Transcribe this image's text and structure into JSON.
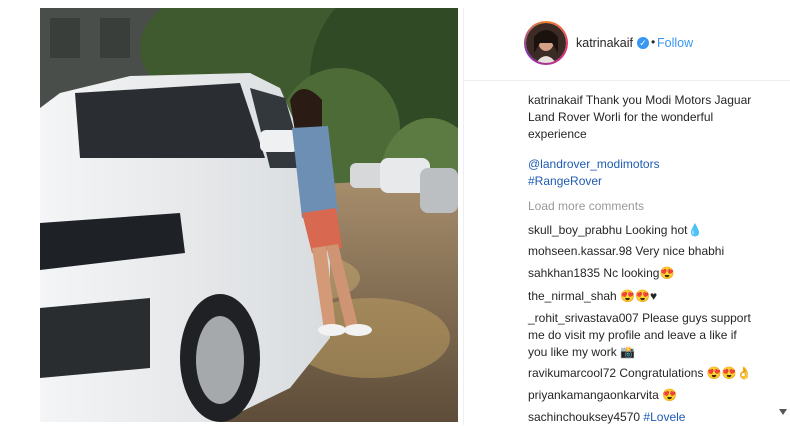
{
  "post": {
    "username": "katrinakaif",
    "follow_label": "Follow",
    "dot": "•",
    "caption_user": "katrinakaif",
    "caption_text": "Thank you Modi Motors Jaguar Land Rover Worli for the wonderful experience",
    "mention": "@landrover_modimotors",
    "hashtag": "#RangeRover",
    "load_more": "Load more comments"
  },
  "comments": [
    {
      "user": "skull_boy_prabhu",
      "text": "Looking hot💧"
    },
    {
      "user": "mohseen.kassar.98",
      "text": "Very nice bhabhi"
    },
    {
      "user": "sahkhan1835",
      "text": "Nc looking😍"
    },
    {
      "user": "the_nirmal_shah",
      "text": "😍😍♥"
    },
    {
      "user": "_rohit_srivastava007",
      "text": "Please guys support me do visit my profile and leave a like if you like my work 📸"
    },
    {
      "user": "ravikumarcool72",
      "text": "Congratulations 😍😍👌"
    },
    {
      "user": "priyankamangaonkarvita",
      "text": "😍"
    },
    {
      "user": "sachinchouksey4570",
      "text": "#Lovele"
    }
  ],
  "colors": {
    "link": "#3897f0",
    "verified": "#3897f0"
  },
  "icons": {
    "verified": "verified-badge-icon"
  }
}
